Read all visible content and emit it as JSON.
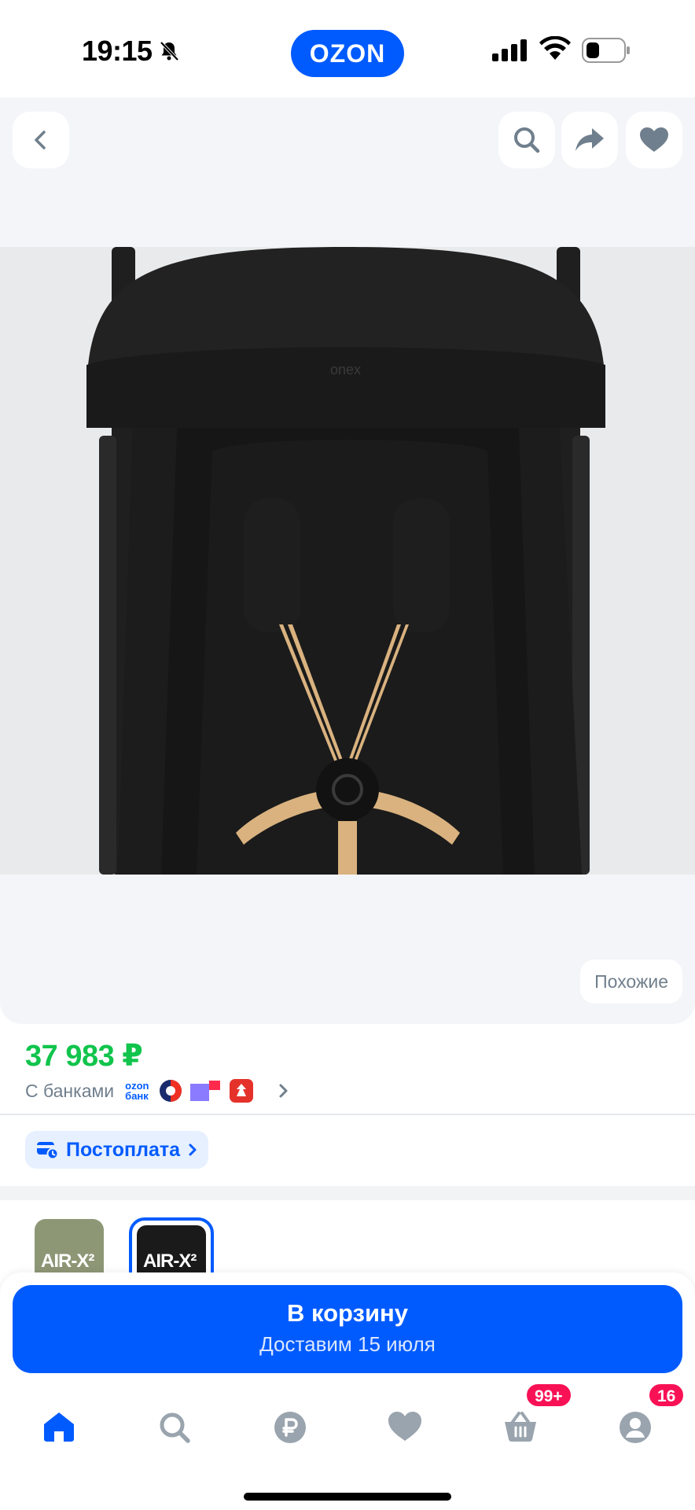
{
  "status_bar": {
    "time": "19:15",
    "logo": "OZON"
  },
  "gallery": {
    "similar_label": "Похожие",
    "image_brand_text": "onex"
  },
  "price": {
    "value": "37 983 ₽",
    "with_banks_label": "С банками",
    "ozon_bank_line1": "ozon",
    "ozon_bank_line2": "банк"
  },
  "postpay": {
    "label": "Постоплата"
  },
  "variants": [
    {
      "label": "AIR-X²",
      "selected": false
    },
    {
      "label": "AIR-X²",
      "selected": true
    }
  ],
  "cart": {
    "title": "В корзину",
    "subtitle": "Доставим 15 июля"
  },
  "tab_bar": {
    "cart_badge": "99+",
    "profile_badge": "16"
  },
  "colors": {
    "brand": "#005bff",
    "price": "#10c44c",
    "badge": "#f91155"
  }
}
